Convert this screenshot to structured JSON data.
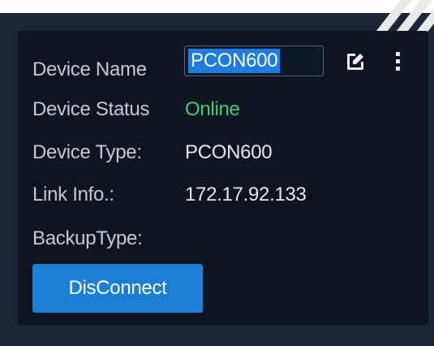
{
  "device": {
    "name_label": "Device Name",
    "name_value": "PCON600",
    "status_label": "Device Status",
    "status_value": "Online",
    "type_label": "Device Type:",
    "type_value": "PCON600",
    "link_label": "Link Info.:",
    "link_value": "172.17.92.133",
    "backup_label": "BackupType:",
    "backup_value": ""
  },
  "actions": {
    "disconnect_label": "DisConnect",
    "edit_icon": "edit-icon",
    "more_icon": "more-vertical-icon"
  },
  "colors": {
    "panel": "#0e1521",
    "accent": "#1b7fd6",
    "online": "#3fcc7a"
  }
}
